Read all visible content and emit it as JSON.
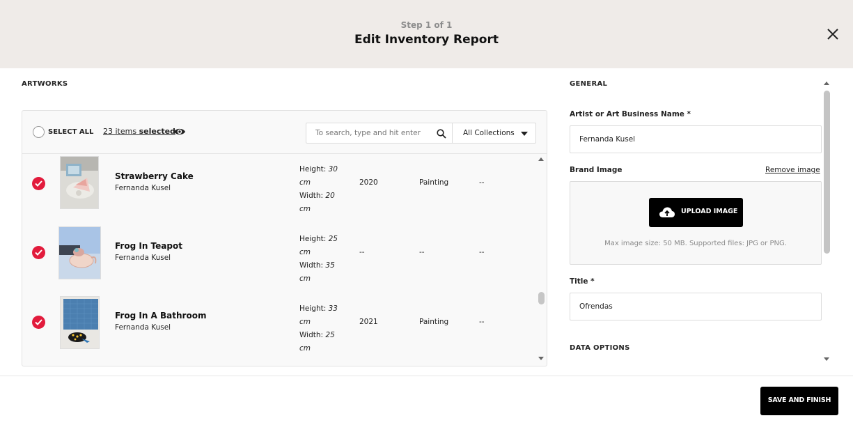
{
  "header": {
    "step": "Step 1 of 1",
    "title": "Edit Inventory Report"
  },
  "artworks": {
    "section_label": "ARTWORKS",
    "select_all_label": "SELECT ALL",
    "items_selected_prefix": "23 items",
    "items_selected_suffix": "selected",
    "search_placeholder": "To search, type and hit enter",
    "collections_value": "All Collections",
    "rows": [
      {
        "title": "Strawberry Cake",
        "artist": "Fernanda Kusel",
        "height_label": "Height:",
        "height": "30 cm",
        "width_label": "Width:",
        "width": "20 cm",
        "year": "2020",
        "medium": "Painting",
        "extra": "--",
        "checked": true
      },
      {
        "title": "Frog In Teapot",
        "artist": "Fernanda Kusel",
        "height_label": "Height:",
        "height": "25 cm",
        "width_label": "Width:",
        "width": "35 cm",
        "year": "--",
        "medium": "--",
        "extra": "--",
        "checked": true
      },
      {
        "title": "Frog In A Bathroom",
        "artist": "Fernanda Kusel",
        "height_label": "Height:",
        "height": "33 cm",
        "width_label": "Width:",
        "width": "25 cm",
        "year": "2021",
        "medium": "Painting",
        "extra": "--",
        "checked": true
      }
    ]
  },
  "general": {
    "section_label": "GENERAL",
    "artist_label": "Artist or Art Business Name *",
    "artist_value": "Fernanda Kusel",
    "brand_image_label": "Brand Image",
    "remove_image": "Remove image",
    "upload_label": "UPLOAD IMAGE",
    "upload_hint": "Max image size: 50 MB. Supported files: JPG or PNG.",
    "title_label": "Title *",
    "title_value": "Ofrendas",
    "data_options_label": "DATA OPTIONS"
  },
  "footer": {
    "save_label": "SAVE AND FINISH"
  },
  "colors": {
    "header_bg": "#efebe8",
    "check_red": "#e21b3c",
    "button_black": "#000000"
  }
}
